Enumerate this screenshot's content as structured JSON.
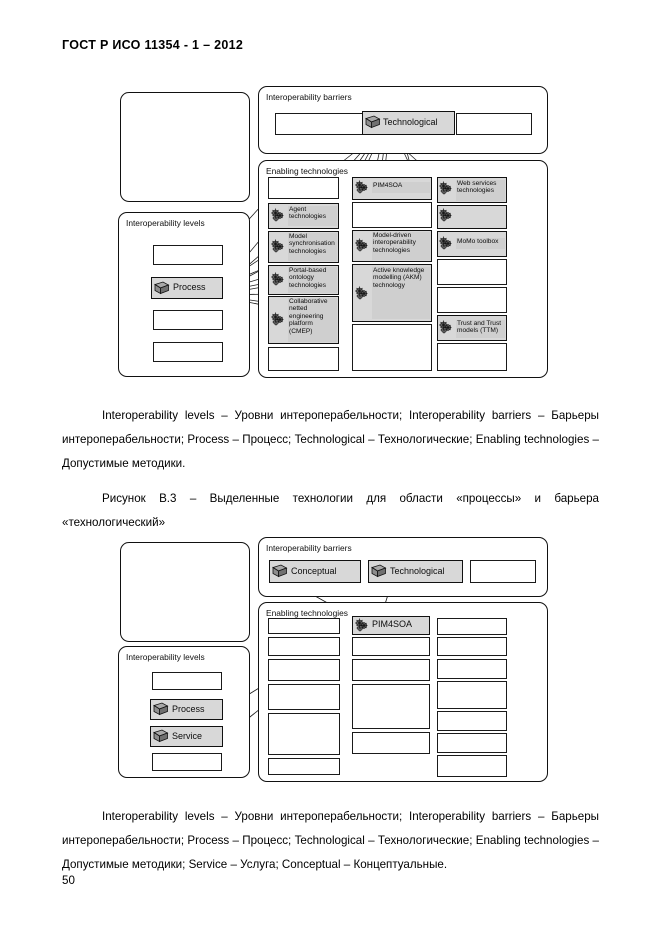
{
  "document": {
    "header": "ГОСТ Р ИСО 11354 - 1 – 2012",
    "page_number": "50"
  },
  "figure1": {
    "barriers_panel_label": "Interoperability barriers",
    "enabling_panel_label": "Enabling technologies",
    "levels_panel_label": "Interoperability levels",
    "barriers": [
      {
        "label": "",
        "highlighted": false
      },
      {
        "label": "Technological",
        "highlighted": true
      },
      {
        "label": "",
        "highlighted": false
      }
    ],
    "levels": [
      {
        "label": "",
        "highlighted": false
      },
      {
        "label": "Process",
        "highlighted": true
      },
      {
        "label": "",
        "highlighted": false
      },
      {
        "label": "",
        "highlighted": false
      }
    ],
    "technologies_col1": [
      {
        "label": "",
        "highlighted": false
      },
      {
        "label": "Agent technologies",
        "highlighted": true
      },
      {
        "label": "Model synchronisation technologies",
        "highlighted": true
      },
      {
        "label": "Portal-based ontology technologies",
        "highlighted": true
      },
      {
        "label": "Collaborative netted engineering platform (CMEP)",
        "highlighted": true
      },
      {
        "label": "",
        "highlighted": false
      }
    ],
    "technologies_col2": [
      {
        "label": "PIM4SOA",
        "highlighted": true
      },
      {
        "label": "",
        "highlighted": false
      },
      {
        "label": "Model-driven interoperability technologies",
        "highlighted": true
      },
      {
        "label": "Active knowledge modelling (AKM) technology",
        "highlighted": true
      },
      {
        "label": "",
        "highlighted": false
      }
    ],
    "technologies_col3": [
      {
        "label": "Web services technologies",
        "highlighted": true
      },
      {
        "label": "",
        "highlighted": false
      },
      {
        "label": "MoMo toolbox",
        "highlighted": true
      },
      {
        "label": "",
        "highlighted": false
      },
      {
        "label": "",
        "highlighted": false
      },
      {
        "label": "Trust and Trust models (TTM)",
        "highlighted": true
      },
      {
        "label": "",
        "highlighted": false
      }
    ]
  },
  "figure1_legend": {
    "text": "Interoperability levels – Уровни интероперабельности; Interoperability barriers – Барьеры интероперабельности; Process – Процесс; Technological – Технологические; Enabling technologies – Допустимые методики."
  },
  "figure1_caption": {
    "text": "Рисунок В.3 – Выделенные технологии для области «процессы» и барьера «технологический»"
  },
  "figure2": {
    "barriers_panel_label": "Interoperability barriers",
    "enabling_panel_label": "Enabling technologies",
    "levels_panel_label": "Interoperability levels",
    "barriers": [
      {
        "label": "Conceptual",
        "highlighted": true
      },
      {
        "label": "Technological",
        "highlighted": true
      },
      {
        "label": "",
        "highlighted": false
      }
    ],
    "levels": [
      {
        "label": "",
        "highlighted": false
      },
      {
        "label": "Process",
        "highlighted": true
      },
      {
        "label": "Service",
        "highlighted": true
      },
      {
        "label": "",
        "highlighted": false
      }
    ],
    "technologies_col1": [
      {
        "label": "",
        "highlighted": false
      },
      {
        "label": "",
        "highlighted": false
      },
      {
        "label": "",
        "highlighted": false
      },
      {
        "label": "",
        "highlighted": false
      },
      {
        "label": "",
        "highlighted": false
      },
      {
        "label": "",
        "highlighted": false
      }
    ],
    "technologies_col2": [
      {
        "label": "PIM4SOA",
        "highlighted": true
      },
      {
        "label": "",
        "highlighted": false
      },
      {
        "label": "",
        "highlighted": false
      },
      {
        "label": "",
        "highlighted": false
      },
      {
        "label": "",
        "highlighted": false
      }
    ],
    "technologies_col3": [
      {
        "label": "",
        "highlighted": false
      },
      {
        "label": "",
        "highlighted": false
      },
      {
        "label": "",
        "highlighted": false
      },
      {
        "label": "",
        "highlighted": false
      },
      {
        "label": "",
        "highlighted": false
      },
      {
        "label": "",
        "highlighted": false
      },
      {
        "label": "",
        "highlighted": false
      }
    ]
  },
  "figure2_legend": {
    "text": "Interoperability levels – Уровни интероперабельности; Interoperability barriers – Барьеры интероперабельности; Process – Процесс; Technological – Технологические; Enabling technologies – Допустимые методики; Service – Услуга; Conceptual – Концептуальные."
  },
  "colors": {
    "highlight_fill": "#d8d8d8",
    "text_highlight": "#cfcfcf",
    "stroke": "#111111"
  }
}
